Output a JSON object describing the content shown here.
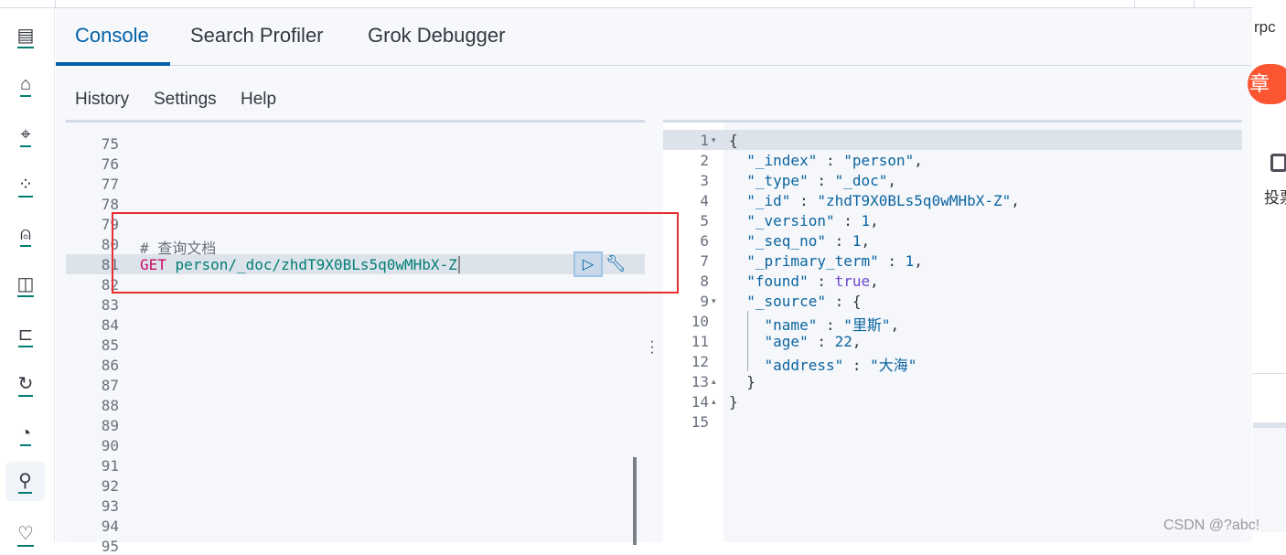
{
  "tabs": [
    {
      "label": "Console",
      "active": true
    },
    {
      "label": "Search Profiler"
    },
    {
      "label": "Grok Debugger"
    }
  ],
  "toolbar": {
    "history": "History",
    "settings": "Settings",
    "help": "Help"
  },
  "request_editor": {
    "first_line": 75,
    "last_line": 95,
    "active_line": 81,
    "comment": "# 查询文档",
    "method": "GET",
    "path": "person/_doc/zhdT9X0BLs5q0wMHbX-Z",
    "run_icon": "play-icon",
    "wrench_icon": "wrench-icon"
  },
  "response": {
    "lines": [
      "{",
      "  \"_index\" : \"person\",",
      "  \"_type\" : \"_doc\",",
      "  \"_id\" : \"zhdT9X0BLs5q0wMHbX-Z\",",
      "  \"_version\" : 1,",
      "  \"_seq_no\" : 1,",
      "  \"_primary_term\" : 1,",
      "  \"found\" : true,",
      "  \"_source\" : {",
      "    \"name\" : \"里斯\",",
      "    \"age\" : 22,",
      "    \"address\" : \"大海\"",
      "  }",
      "}",
      ""
    ]
  },
  "sidebar_icons": [
    "overview-icon",
    "dashboard-icon",
    "maps-icon",
    "ml-icon",
    "graph-icon",
    "apm-icon",
    "uptime-icon",
    "slo-icon",
    "network-icon",
    "dev-tools-icon",
    "monitoring-icon"
  ],
  "background_page": {
    "text1": "rpc",
    "button": "章",
    "vote": "投票"
  },
  "watermark": "CSDN @?abc!",
  "colors": {
    "accent": "#0061a6",
    "highlight_box": "#e7302f"
  }
}
